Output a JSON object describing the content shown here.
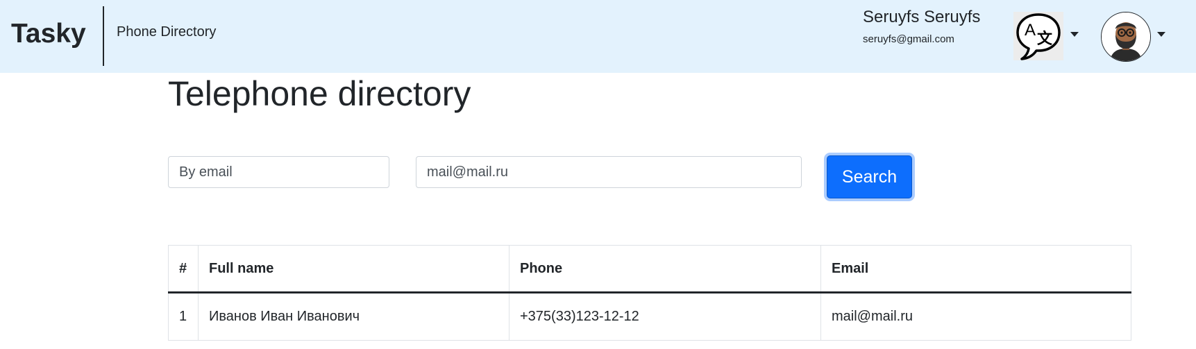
{
  "navbar": {
    "brand": "Tasky",
    "link": "Phone Directory",
    "user_name": "Seruyfs Seruyfs",
    "user_email": "seruyfs@gmail.com",
    "language_icon": "translate-icon",
    "avatar_icon": "avatar-icon",
    "background": "#e3f2fd"
  },
  "page": {
    "title": "Telephone directory"
  },
  "search": {
    "filter_value": "By email",
    "query_value": "mail@mail.ru",
    "button_label": "Search",
    "button_color": "#0d6efd"
  },
  "table": {
    "headers": [
      "#",
      "Full name",
      "Phone",
      "Email"
    ],
    "rows": [
      [
        "1",
        "Иванов Иван Иванович",
        "+375(33)123-12-12",
        "mail@mail.ru"
      ]
    ]
  }
}
